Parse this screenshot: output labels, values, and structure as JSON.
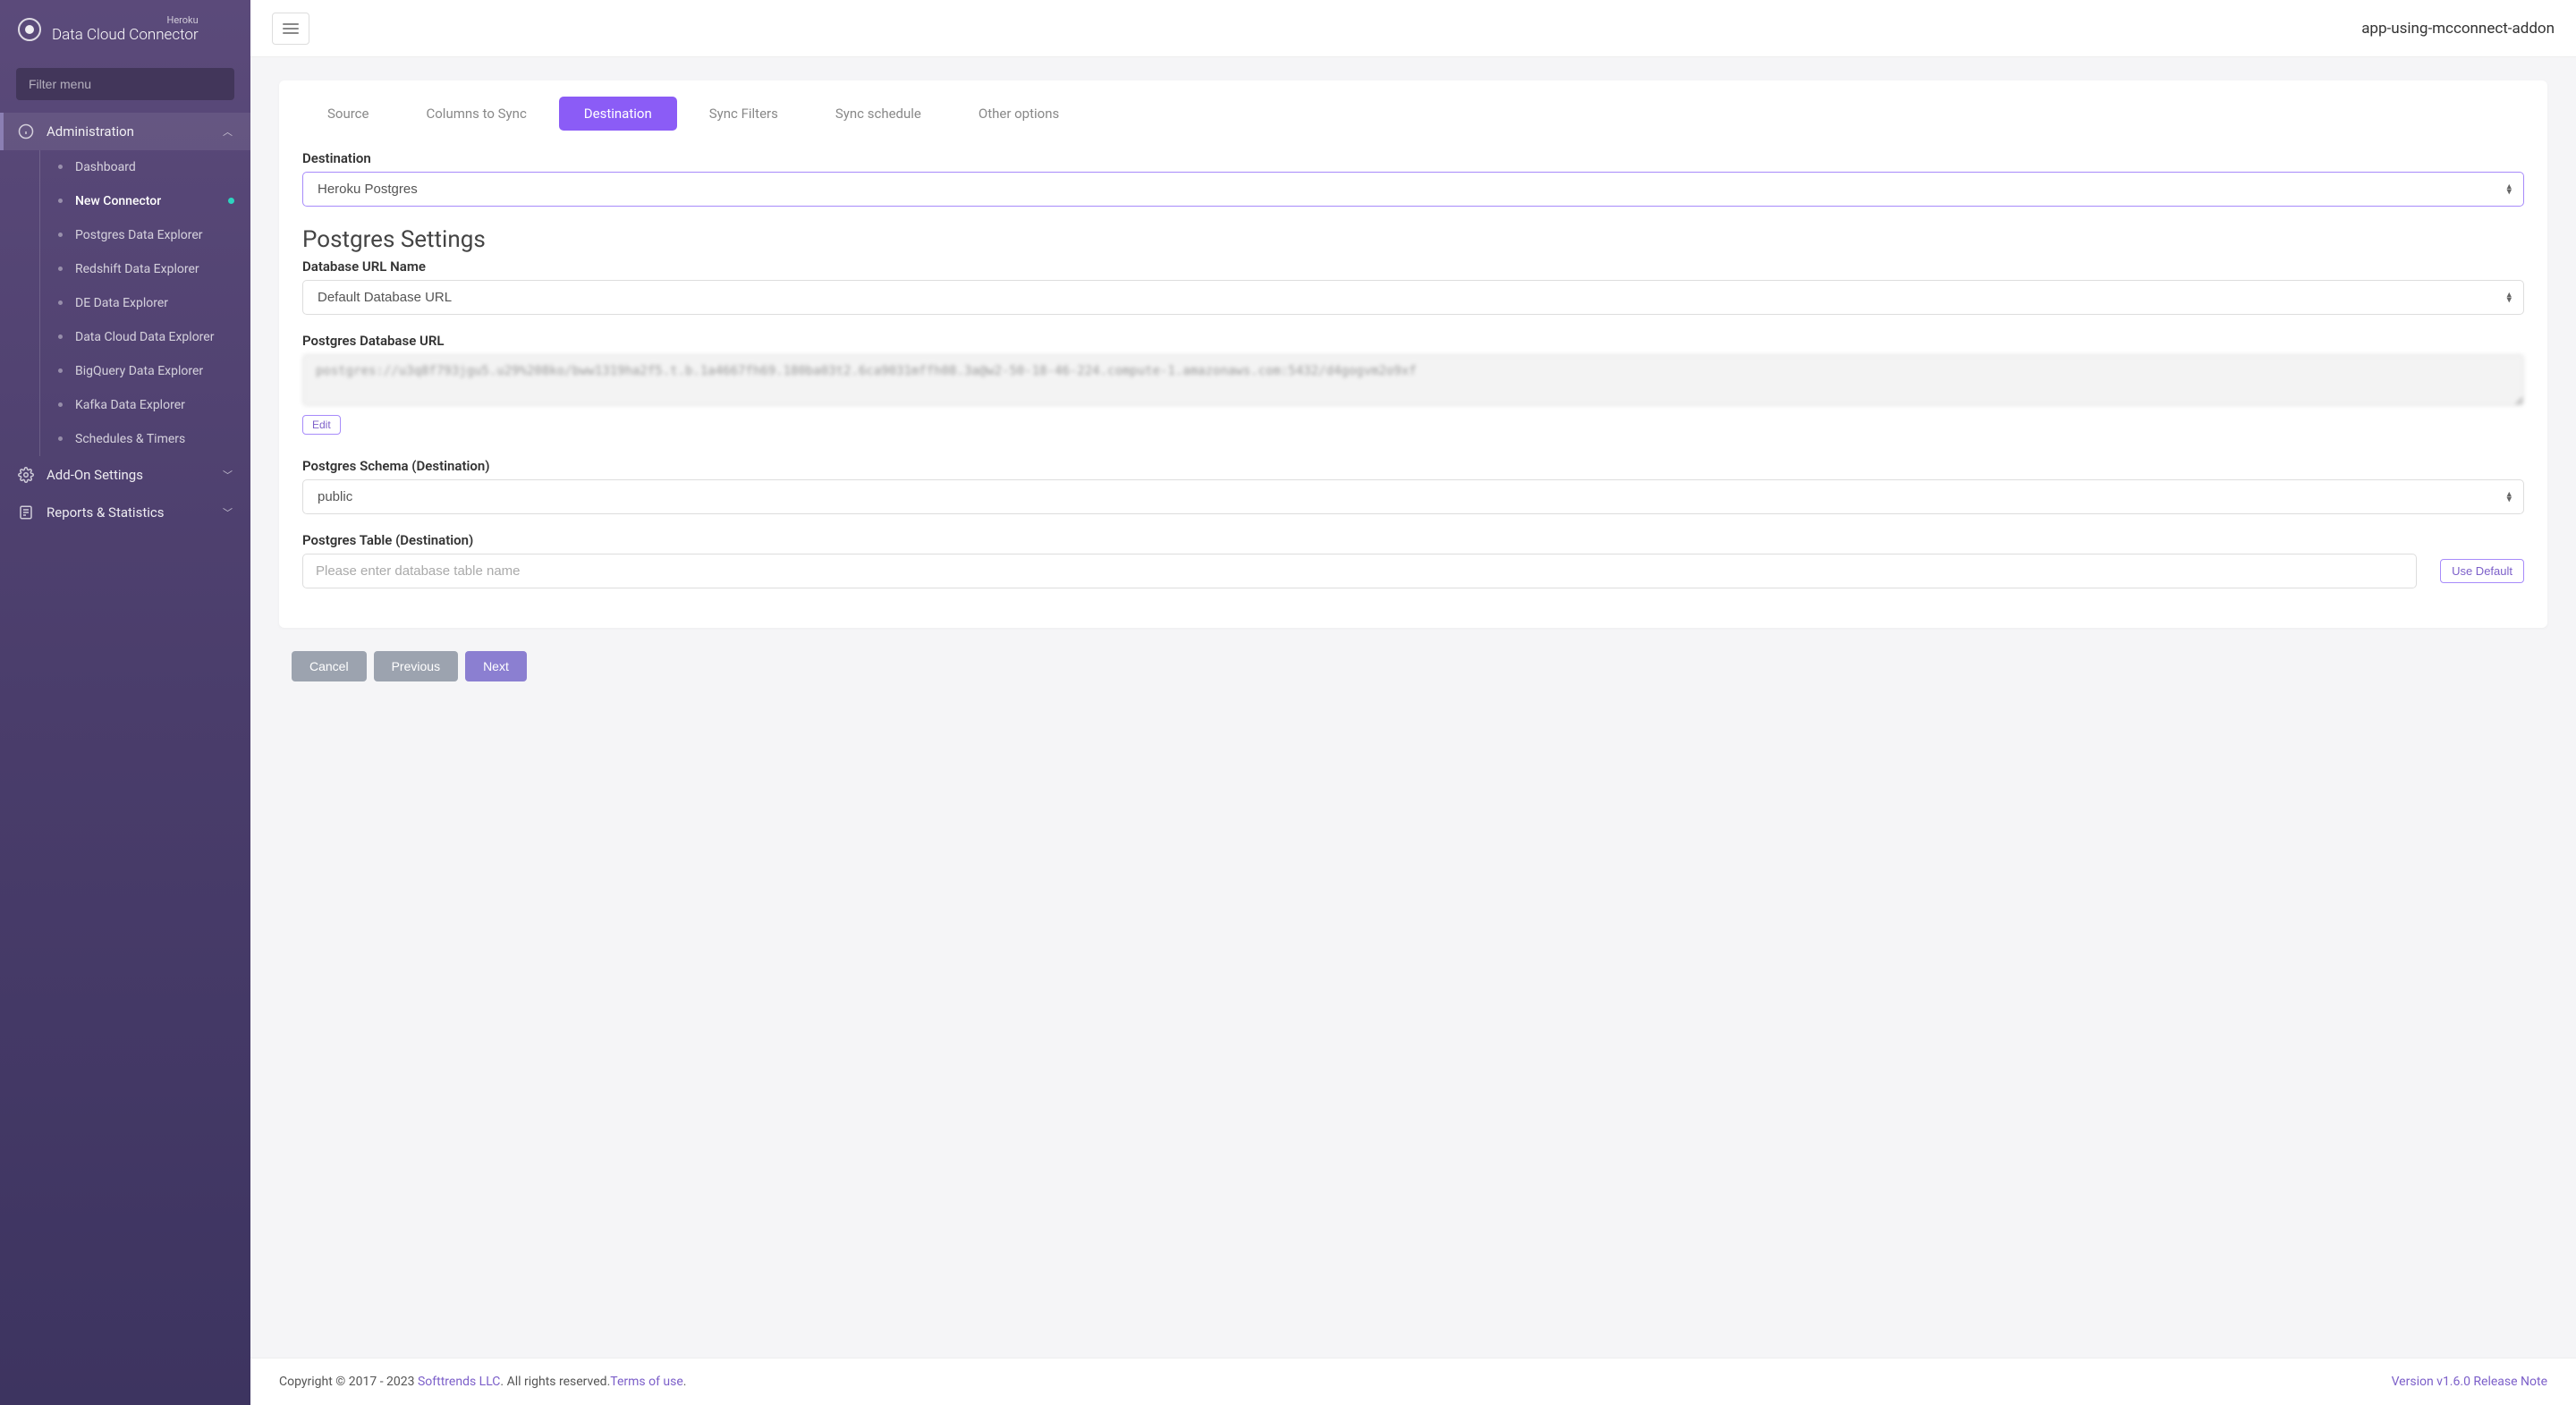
{
  "brand": {
    "sub": "Heroku",
    "main": "Data Cloud Connector"
  },
  "filter": {
    "placeholder": "Filter menu"
  },
  "sidebar": {
    "sections": [
      {
        "label": "Administration",
        "expanded": true
      },
      {
        "label": "Add-On Settings",
        "expanded": false
      },
      {
        "label": "Reports & Statistics",
        "expanded": false
      }
    ],
    "items": [
      {
        "label": "Dashboard"
      },
      {
        "label": "New Connector"
      },
      {
        "label": "Postgres Data Explorer"
      },
      {
        "label": "Redshift Data Explorer"
      },
      {
        "label": "DE Data Explorer"
      },
      {
        "label": "Data Cloud Data Explorer"
      },
      {
        "label": "BigQuery Data Explorer"
      },
      {
        "label": "Kafka Data Explorer"
      },
      {
        "label": "Schedules & Timers"
      }
    ]
  },
  "topbar": {
    "app_name": "app-using-mcconnect-addon"
  },
  "tabs": [
    {
      "label": "Source"
    },
    {
      "label": "Columns to Sync"
    },
    {
      "label": "Destination"
    },
    {
      "label": "Sync Filters"
    },
    {
      "label": "Sync schedule"
    },
    {
      "label": "Other options"
    }
  ],
  "form": {
    "destination_label": "Destination",
    "destination_value": "Heroku Postgres",
    "section_title": "Postgres Settings",
    "db_url_name_label": "Database URL Name",
    "db_url_name_value": "Default Database URL",
    "db_url_label": "Postgres Database URL",
    "db_url_value": "postgres://u3q8f793jgu5.u29%208ko/bww1319ha2f5.t.b.1a4667fh69.180ba03t2.6ca9031mffh08.3a@w2-50-18-46-224.compute-1.amazonaws.com:5432/d4gogvm2o9xf",
    "edit_label": "Edit",
    "schema_label": "Postgres Schema (Destination)",
    "schema_value": "public",
    "table_label": "Postgres Table (Destination)",
    "table_placeholder": "Please enter database table name",
    "use_default_label": "Use Default"
  },
  "actions": {
    "cancel": "Cancel",
    "previous": "Previous",
    "next": "Next"
  },
  "footer": {
    "copyright_prefix": "Copyright © 2017 - 2023 ",
    "company": "Softtrends LLC",
    "rights": ". All rights reserved.",
    "terms": "Terms of use",
    "dot": ".",
    "version_prefix": "Version v1.6.0  ",
    "release_note": "Release Note"
  }
}
